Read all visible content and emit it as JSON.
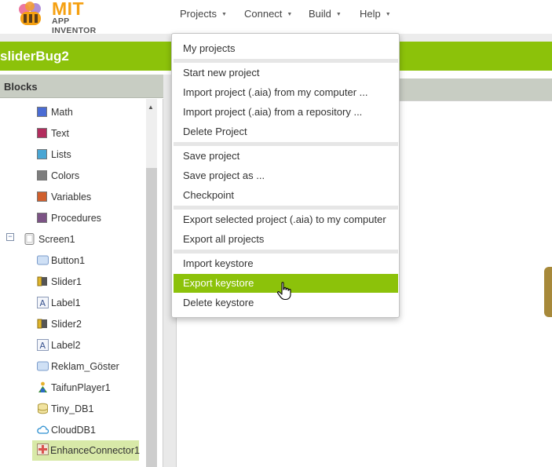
{
  "logo": {
    "title": "MIT",
    "subtitle": "APP INVENTOR"
  },
  "topnav": [
    {
      "label": "Projects"
    },
    {
      "label": "Connect"
    },
    {
      "label": "Build"
    },
    {
      "label": "Help"
    }
  ],
  "project": {
    "name": "sliderBug2"
  },
  "blocks": {
    "title": "Blocks",
    "builtins": [
      {
        "label": "Math",
        "color": "#4a6cd4"
      },
      {
        "label": "Text",
        "color": "#b32d5e"
      },
      {
        "label": "Lists",
        "color": "#49a6d4"
      },
      {
        "label": "Colors",
        "color": "#7d7d7d"
      },
      {
        "label": "Variables",
        "color": "#d05f2d"
      },
      {
        "label": "Procedures",
        "color": "#7c5385"
      }
    ],
    "screen": {
      "label": "Screen1"
    },
    "components": [
      {
        "label": "Button1",
        "icon": "button-icon"
      },
      {
        "label": "Slider1",
        "icon": "slider-icon"
      },
      {
        "label": "Label1",
        "icon": "label-icon"
      },
      {
        "label": "Slider2",
        "icon": "slider-icon"
      },
      {
        "label": "Label2",
        "icon": "label-icon"
      },
      {
        "label": "Reklam_Göster",
        "icon": "button-icon"
      },
      {
        "label": "TaifunPlayer1",
        "icon": "player-icon"
      },
      {
        "label": "Tiny_DB1",
        "icon": "database-icon"
      },
      {
        "label": "CloudDB1",
        "icon": "cloud-icon"
      },
      {
        "label": "EnhanceConnector1",
        "icon": "extension-icon"
      }
    ]
  },
  "projects_menu": {
    "groups": [
      [
        "My projects"
      ],
      [
        "Start new project",
        "Import project (.aia) from my computer ...",
        "Import project (.aia) from a repository ...",
        "Delete Project"
      ],
      [
        "Save project",
        "Save project as ...",
        "Checkpoint"
      ],
      [
        "Export selected project (.aia) to my computer",
        "Export all projects"
      ],
      [
        "Import keystore",
        "Export keystore",
        "Delete keystore"
      ]
    ],
    "highlighted": "Export keystore",
    "accent_color": "#8cc20a"
  }
}
